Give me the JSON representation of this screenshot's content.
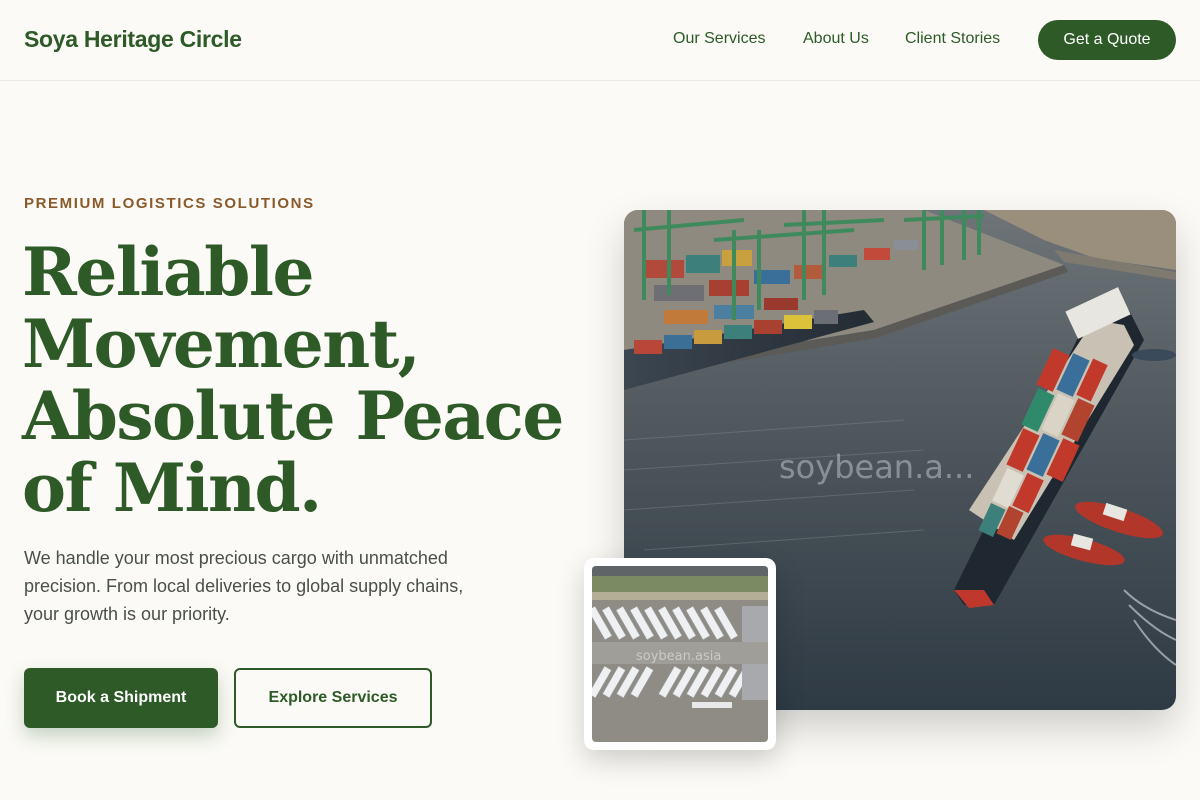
{
  "header": {
    "brand": "Soya Heritage Circle",
    "nav": [
      {
        "label": "Our Services"
      },
      {
        "label": "About Us"
      },
      {
        "label": "Client Stories"
      }
    ],
    "cta_label": "Get a Quote"
  },
  "hero": {
    "eyebrow": "PREMIUM LOGISTICS SOLUTIONS",
    "headline_lines": [
      "Reliable",
      "Movement,",
      "Absolute Peace",
      "of Mind."
    ],
    "description_lines": [
      "We handle your most precious cargo with unmatched",
      "precision. From local deliveries to global supply chains,",
      "your growth is our priority."
    ],
    "primary_button": "Book a Shipment",
    "secondary_button": "Explore Services"
  },
  "images": {
    "main_watermark": "soybean.a...",
    "thumb_watermark": "soybean.asia"
  },
  "colors": {
    "brand_green": "#2d5a27",
    "accent_brown": "#8a5a2b",
    "background": "#fbfaf6",
    "body_text": "#4a4f4a"
  }
}
